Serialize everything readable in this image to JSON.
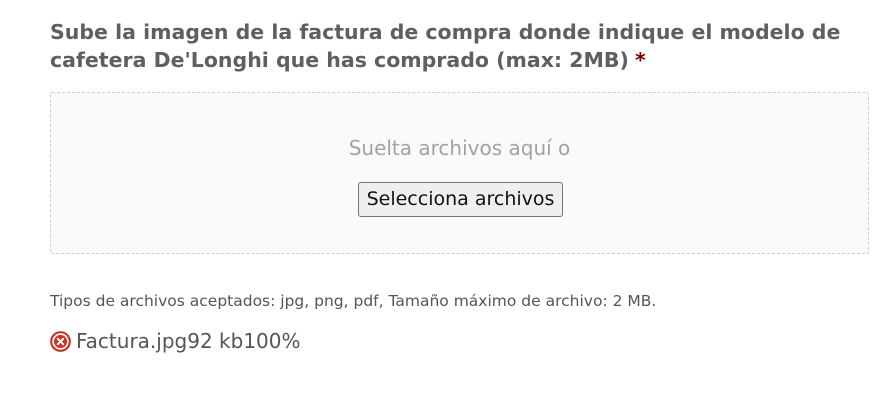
{
  "field": {
    "label": "Sube la imagen de la factura de compra donde indique el modelo de cafetera De'Longhi que has comprado (max: 2MB)",
    "required_marker": "*"
  },
  "dropzone": {
    "drop_text": "Suelta archivos aquí o",
    "select_button_label": "Selecciona archivos"
  },
  "hint": "Tipos de archivos aceptados: jpg, png, pdf, Tamaño máximo de archivo: 2 MB.",
  "uploaded_file": {
    "name": "Factura.jpg",
    "size": "92 kb",
    "progress": "100%",
    "remove_icon": "remove-circle-x-icon"
  },
  "colors": {
    "label_text": "#5f5f5f",
    "required_marker": "#790000",
    "remove_icon": "#c0392b",
    "dropzone_border": "#cfcfcf",
    "dropzone_bg": "#fafafa"
  }
}
